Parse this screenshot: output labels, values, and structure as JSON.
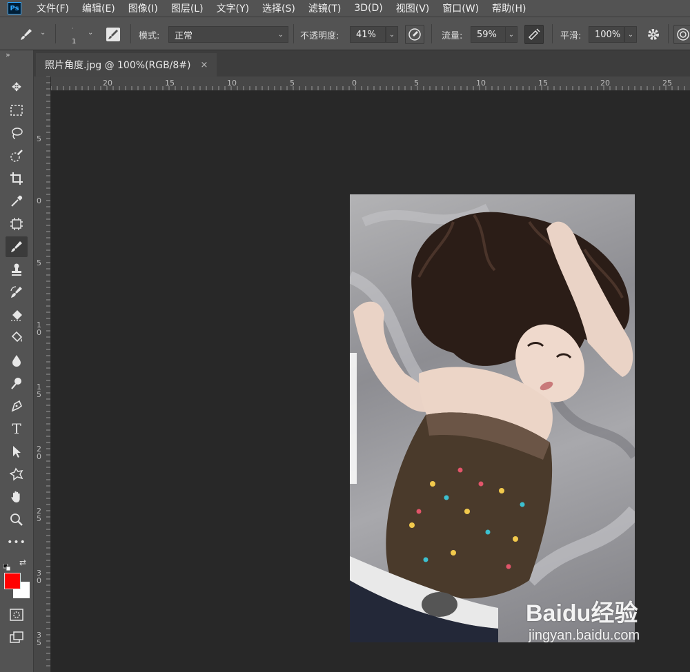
{
  "app": {
    "logo": "Ps"
  },
  "menu": [
    "文件(F)",
    "编辑(E)",
    "图像(I)",
    "图层(L)",
    "文字(Y)",
    "选择(S)",
    "滤镜(T)",
    "3D(D)",
    "视图(V)",
    "窗口(W)",
    "帮助(H)"
  ],
  "options": {
    "brush_size": "1",
    "mode_label": "模式:",
    "mode_value": "正常",
    "opacity_label": "不透明度:",
    "opacity_value": "41%",
    "flow_label": "流量:",
    "flow_value": "59%",
    "smooth_label": "平滑:",
    "smooth_value": "100%"
  },
  "document": {
    "tab_title": "照片角度.jpg @ 100%(RGB/8#)",
    "close_glyph": "×"
  },
  "rulers": {
    "horizontal_labels": [
      "20",
      "15",
      "10",
      "5",
      "0",
      "5",
      "10",
      "15",
      "20",
      "25"
    ],
    "vertical_labels": [
      "5",
      "0",
      "5",
      "1 0",
      "1 5",
      "2 0",
      "2 5",
      "3 0",
      "3 5"
    ]
  },
  "colors": {
    "foreground": "#ff0000",
    "background": "#ffffff",
    "chrome": "#535353",
    "canvas": "#282828"
  },
  "watermark": {
    "brand": "Baidu经验",
    "url": "jingyan.baidu.com"
  },
  "toolbar_collapse_glyph": "»",
  "tools": [
    "move-icon",
    "marquee-icon",
    "lasso-icon",
    "quick-select-icon",
    "crop-icon",
    "eyedropper-icon",
    "frame-icon",
    "brush-icon",
    "stamp-icon",
    "history-brush-icon",
    "eraser-icon",
    "bucket-icon",
    "blur-icon",
    "dodge-icon",
    "pen-icon",
    "type-icon",
    "path-select-icon",
    "shape-icon",
    "hand-icon",
    "zoom-icon",
    "more-icon"
  ]
}
